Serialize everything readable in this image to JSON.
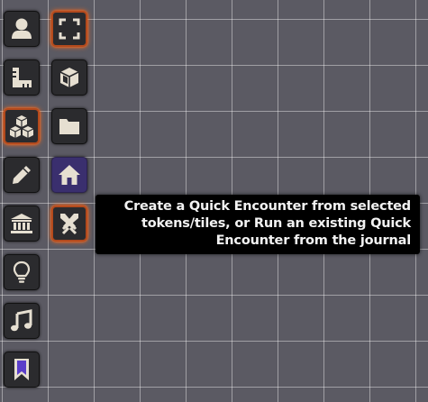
{
  "scene_controls": {
    "primary": [
      {
        "name": "token-controls",
        "icon": "user-icon",
        "active": false
      },
      {
        "name": "measurement-controls",
        "icon": "ruler-icon",
        "active": false
      },
      {
        "name": "tile-controls",
        "icon": "cubes-icon",
        "active": true
      },
      {
        "name": "drawing-tools",
        "icon": "pencil-icon",
        "active": false
      },
      {
        "name": "wall-controls",
        "icon": "landmark-icon",
        "active": false
      },
      {
        "name": "lighting-controls",
        "icon": "lightbulb-icon",
        "active": false
      },
      {
        "name": "ambient-sound-controls",
        "icon": "music-icon",
        "active": false
      },
      {
        "name": "journal-notes",
        "icon": "bookmark-icon",
        "active": false
      }
    ],
    "secondary": [
      {
        "name": "select-tiles",
        "icon": "expand-icon",
        "active": true
      },
      {
        "name": "place-tile",
        "icon": "cube-icon",
        "active": false
      },
      {
        "name": "browse-tiles",
        "icon": "folder-icon",
        "active": false
      },
      {
        "name": "foreground-toggle",
        "icon": "home-icon",
        "active": false,
        "hovered": true
      },
      {
        "name": "quick-encounter",
        "icon": "crossed-swords-icon",
        "active": true
      }
    ]
  },
  "tooltip": {
    "lines": [
      "Create a Quick Encounter from selected",
      "tokens/tiles, or Run an existing Quick",
      "Encounter from the journal"
    ]
  },
  "colors": {
    "canvas_background": "#5b5a63",
    "grid_line": "#a9a8ae",
    "button_background": "#2b2b2e",
    "icon_fill": "#e6dfd1",
    "active_glow": "#ff6a1a",
    "hover_background": "#3a2f6e",
    "bookmark_accent": "#5b3ec9",
    "tooltip_background": "#000000",
    "tooltip_text": "#f2f2f2"
  }
}
